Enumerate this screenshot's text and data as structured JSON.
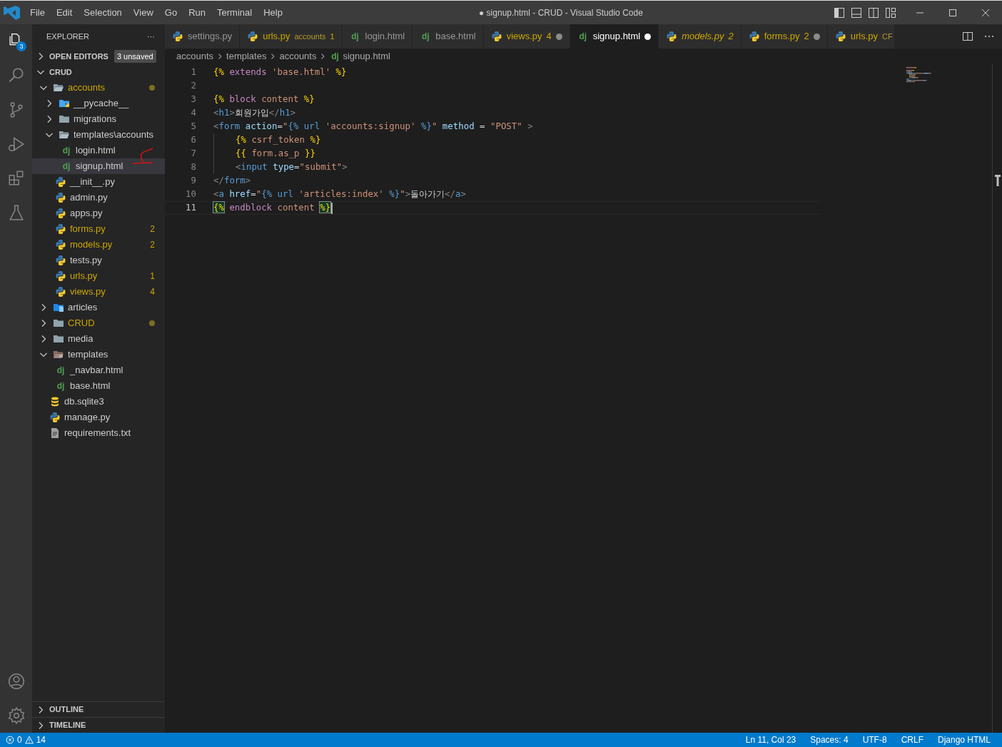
{
  "window": {
    "title": "● signup.html - CRUD - Visual Studio Code"
  },
  "menu": [
    "File",
    "Edit",
    "Selection",
    "View",
    "Go",
    "Run",
    "Terminal",
    "Help"
  ],
  "activity_bar": {
    "explorer_badge": "3"
  },
  "explorer": {
    "title": "EXPLORER",
    "more": "···",
    "open_editors": {
      "label": "OPEN EDITORS",
      "badge": "3 unsaved",
      "expanded": false
    },
    "root": {
      "label": "CRUD",
      "expanded": true
    },
    "tree": [
      {
        "name": "accounts",
        "kind": "folder",
        "expanded": true,
        "modified": true,
        "dot": true,
        "selected": false,
        "children": [
          {
            "name": "__pycache__",
            "kind": "folder-python",
            "expanded": false,
            "modified": false,
            "selected": false
          },
          {
            "name": "migrations",
            "kind": "folder",
            "expanded": false,
            "modified": false,
            "selected": false
          },
          {
            "name": "templates\\accounts",
            "kind": "folder",
            "expanded": true,
            "modified": false,
            "selected": false,
            "children": [
              {
                "name": "login.html",
                "kind": "django",
                "glyph": "dj",
                "modified": false,
                "selected": false
              },
              {
                "name": "signup.html",
                "kind": "django",
                "glyph": "dj",
                "modified": false,
                "selected": true
              }
            ]
          },
          {
            "name": "__init__.py",
            "kind": "python",
            "modified": false,
            "selected": false
          },
          {
            "name": "admin.py",
            "kind": "python",
            "modified": false,
            "selected": false
          },
          {
            "name": "apps.py",
            "kind": "python",
            "modified": false,
            "selected": false
          },
          {
            "name": "forms.py",
            "kind": "python",
            "modified": true,
            "badge": "2",
            "selected": false
          },
          {
            "name": "models.py",
            "kind": "python",
            "modified": true,
            "badge": "2",
            "selected": false
          },
          {
            "name": "tests.py",
            "kind": "python",
            "modified": false,
            "selected": false
          },
          {
            "name": "urls.py",
            "kind": "python",
            "modified": true,
            "badge": "1",
            "selected": false
          },
          {
            "name": "views.py",
            "kind": "python",
            "modified": true,
            "badge": "4",
            "selected": false
          }
        ]
      },
      {
        "name": "articles",
        "kind": "folder-blue",
        "expanded": false,
        "modified": false,
        "selected": false
      },
      {
        "name": "CRUD",
        "kind": "folder",
        "expanded": false,
        "modified": true,
        "dot": true,
        "selected": false
      },
      {
        "name": "media",
        "kind": "folder",
        "expanded": false,
        "modified": false,
        "selected": false
      },
      {
        "name": "templates",
        "kind": "folder-templates",
        "expanded": true,
        "modified": false,
        "selected": false,
        "children": [
          {
            "name": "_navbar.html",
            "kind": "django",
            "glyph": "dj",
            "modified": false,
            "selected": false
          },
          {
            "name": "base.html",
            "kind": "django",
            "glyph": "dj",
            "modified": false,
            "selected": false
          }
        ]
      },
      {
        "name": "db.sqlite3",
        "kind": "database",
        "modified": false,
        "selected": false
      },
      {
        "name": "manage.py",
        "kind": "python",
        "modified": false,
        "selected": false
      },
      {
        "name": "requirements.txt",
        "kind": "text",
        "modified": false,
        "selected": false
      }
    ],
    "sections": [
      {
        "label": "OUTLINE",
        "expanded": false
      },
      {
        "label": "TIMELINE",
        "expanded": false
      }
    ]
  },
  "tabs": [
    {
      "label": "settings.py",
      "kind": "python",
      "selected": false,
      "modified": false,
      "italic": false,
      "dirty": false
    },
    {
      "label": "urls.py",
      "detail": "accounts",
      "count": "1",
      "kind": "python",
      "selected": false,
      "modified": true,
      "italic": false,
      "dirty": false
    },
    {
      "label": "login.html",
      "kind": "django",
      "glyph": "dj",
      "selected": false,
      "modified": false,
      "italic": false,
      "dirty": false
    },
    {
      "label": "base.html",
      "kind": "django",
      "glyph": "dj",
      "selected": false,
      "modified": false,
      "italic": false,
      "dirty": false
    },
    {
      "label": "views.py",
      "count": "4",
      "kind": "python",
      "selected": false,
      "modified": true,
      "italic": false,
      "dirty": true
    },
    {
      "label": "signup.html",
      "kind": "django",
      "glyph": "dj",
      "selected": true,
      "modified": false,
      "italic": false,
      "dirty": true
    },
    {
      "label": "models.py",
      "count": "2",
      "kind": "python",
      "selected": false,
      "modified": true,
      "italic": true,
      "dirty": false
    },
    {
      "label": "forms.py",
      "count": "2",
      "kind": "python",
      "selected": false,
      "modified": true,
      "italic": false,
      "dirty": true
    },
    {
      "label": "urls.py",
      "detail": "CF",
      "kind": "python",
      "selected": false,
      "modified": true,
      "italic": false,
      "dirty": false
    }
  ],
  "breadcrumb": {
    "parts": [
      "accounts",
      "templates",
      "accounts"
    ],
    "glyph": "dj",
    "file": "signup.html"
  },
  "code": [
    {
      "number": "1",
      "current": false,
      "tokens": [
        {
          "kind": "bracket",
          "text": "{%"
        },
        {
          "kind": "keyword",
          "text": " extends "
        },
        {
          "kind": "string",
          "text": "'base.html'"
        },
        {
          "kind": "bracket",
          "text": " %}"
        }
      ]
    },
    {
      "number": "2",
      "current": false
    },
    {
      "number": "3",
      "current": false,
      "tokens": [
        {
          "kind": "bracket",
          "text": "{%"
        },
        {
          "kind": "keyword",
          "text": " block "
        },
        {
          "kind": "string",
          "text": "content"
        },
        {
          "kind": "bracket",
          "text": " %}"
        }
      ]
    },
    {
      "number": "4",
      "current": false,
      "tokens": [
        {
          "kind": "punct",
          "text": "<"
        },
        {
          "kind": "tag",
          "text": "h1"
        },
        {
          "kind": "punct",
          "text": ">"
        },
        {
          "kind": "text",
          "text": "회원가입"
        },
        {
          "kind": "punct",
          "text": "</"
        },
        {
          "kind": "tag",
          "text": "h1"
        },
        {
          "kind": "punct",
          "text": ">"
        }
      ]
    },
    {
      "number": "5",
      "current": false,
      "tokens": [
        {
          "kind": "punct",
          "text": "<"
        },
        {
          "kind": "tag",
          "text": "form"
        },
        {
          "kind": "attr",
          "text": " action"
        },
        {
          "kind": "text",
          "text": "="
        },
        {
          "kind": "string",
          "text": "\""
        },
        {
          "kind": "tag",
          "text": "{% url "
        },
        {
          "kind": "string",
          "text": "'accounts:signup'"
        },
        {
          "kind": "tag",
          "text": " %}"
        },
        {
          "kind": "string",
          "text": "\""
        },
        {
          "kind": "attr",
          "text": " method"
        },
        {
          "kind": "text",
          "text": " = "
        },
        {
          "kind": "string",
          "text": "\"POST\""
        },
        {
          "kind": "punct",
          "text": " >"
        }
      ]
    },
    {
      "number": "6",
      "current": false,
      "indent": true,
      "tokens": [
        {
          "kind": "bracket",
          "text": "{%"
        },
        {
          "kind": "string",
          "text": " csrf_token "
        },
        {
          "kind": "bracket",
          "text": "%}"
        }
      ]
    },
    {
      "number": "7",
      "current": false,
      "indent": true,
      "tokens": [
        {
          "kind": "bracket",
          "text": "{{"
        },
        {
          "kind": "string",
          "text": " form.as_p "
        },
        {
          "kind": "bracket",
          "text": "}}"
        }
      ]
    },
    {
      "number": "8",
      "current": false,
      "indent": true,
      "tokens": [
        {
          "kind": "punct",
          "text": "<"
        },
        {
          "kind": "tag",
          "text": "input"
        },
        {
          "kind": "attr",
          "text": " type"
        },
        {
          "kind": "text",
          "text": "="
        },
        {
          "kind": "string",
          "text": "\"submit\""
        },
        {
          "kind": "punct",
          "text": ">"
        }
      ]
    },
    {
      "number": "9",
      "current": false,
      "tokens": [
        {
          "kind": "punct",
          "text": "</"
        },
        {
          "kind": "tag",
          "text": "form"
        },
        {
          "kind": "punct",
          "text": ">"
        }
      ]
    },
    {
      "number": "10",
      "current": false,
      "tokens": [
        {
          "kind": "punct",
          "text": "<"
        },
        {
          "kind": "tag",
          "text": "a"
        },
        {
          "kind": "attr",
          "text": " href"
        },
        {
          "kind": "text",
          "text": "="
        },
        {
          "kind": "string",
          "text": "\""
        },
        {
          "kind": "tag",
          "text": "{% url "
        },
        {
          "kind": "string",
          "text": "'articles:index'"
        },
        {
          "kind": "tag",
          "text": " %}"
        },
        {
          "kind": "string",
          "text": "\""
        },
        {
          "kind": "punct",
          "text": ">"
        },
        {
          "kind": "text",
          "text": "돌아가기"
        },
        {
          "kind": "punct",
          "text": "</"
        },
        {
          "kind": "tag",
          "text": "a"
        },
        {
          "kind": "punct",
          "text": ">"
        }
      ]
    },
    {
      "number": "11",
      "current": true,
      "tokens": [
        {
          "kind": "match",
          "text": "{%"
        },
        {
          "kind": "keyword",
          "text": " endblock "
        },
        {
          "kind": "string",
          "text": "content "
        },
        {
          "kind": "match",
          "text": "%}"
        }
      ]
    }
  ],
  "status_bar": {
    "errors": "0",
    "warnings": "14",
    "items": [
      "Ln 11, Col 23",
      "Spaces: 4",
      "UTF-8",
      "CRLF",
      "Django HTML"
    ]
  }
}
